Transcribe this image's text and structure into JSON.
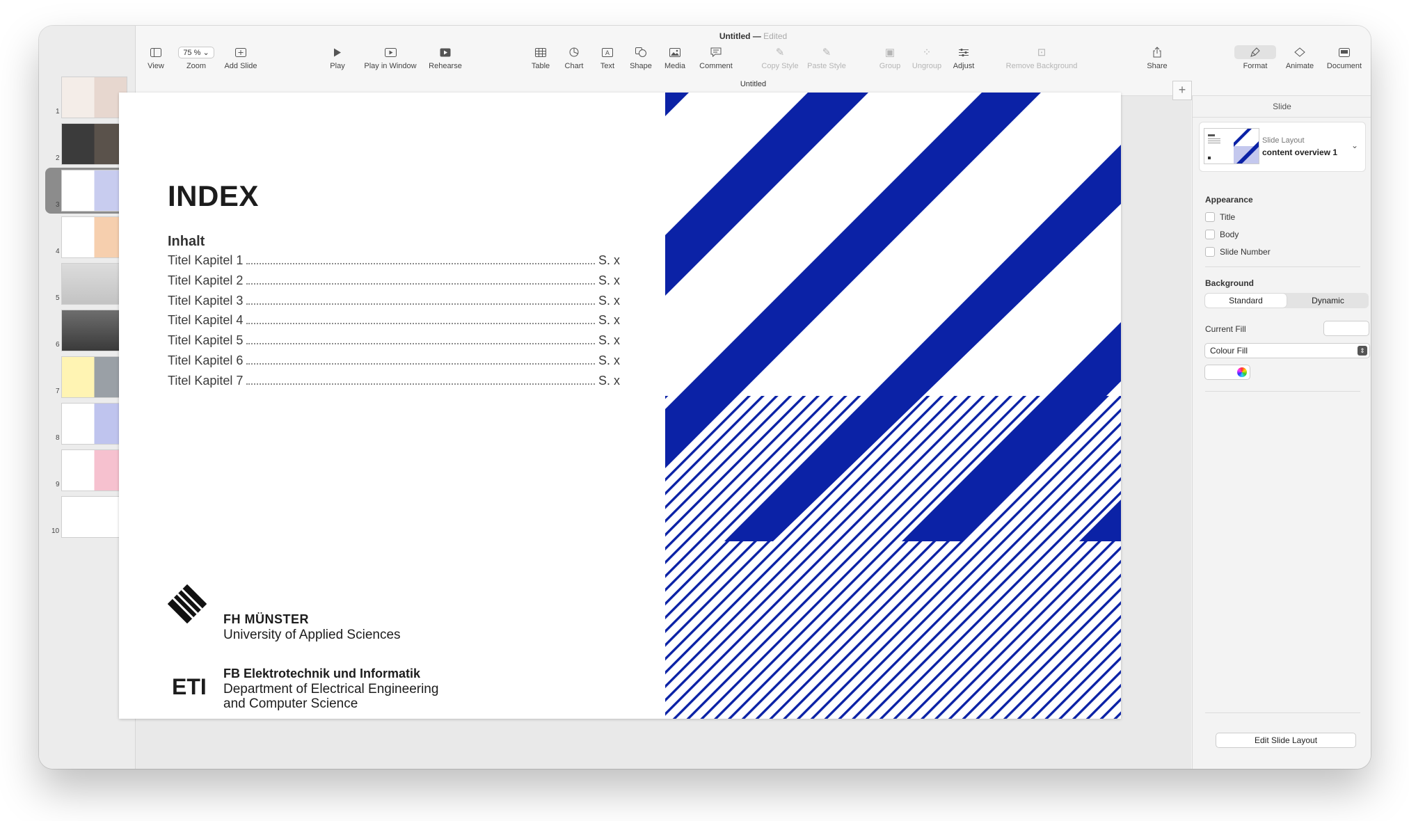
{
  "window": {
    "title": "Untitled",
    "edited_label": "Edited",
    "subtitle": "Untitled"
  },
  "toolbar": {
    "view": "View",
    "zoom": "Zoom",
    "zoom_value": "75 %",
    "add_slide": "Add Slide",
    "play": "Play",
    "play_in_window": "Play in Window",
    "rehearse": "Rehearse",
    "table": "Table",
    "chart": "Chart",
    "text": "Text",
    "shape": "Shape",
    "media": "Media",
    "comment": "Comment",
    "copy_style": "Copy Style",
    "paste_style": "Paste Style",
    "group": "Group",
    "ungroup": "Ungroup",
    "adjust": "Adjust",
    "remove_background": "Remove Background",
    "share": "Share",
    "format": "Format",
    "animate": "Animate",
    "document": "Document"
  },
  "sidebar": {
    "slide_numbers": [
      "1",
      "2",
      "3",
      "4",
      "5",
      "6",
      "7",
      "8",
      "9",
      "10"
    ],
    "selected": "3"
  },
  "slide": {
    "heading": "INDEX",
    "section": "Inhalt",
    "toc": [
      {
        "title": "Titel Kapitel 1",
        "page": "S. x"
      },
      {
        "title": "Titel Kapitel 2",
        "page": "S. x"
      },
      {
        "title": "Titel Kapitel 3",
        "page": "S. x"
      },
      {
        "title": "Titel Kapitel 4",
        "page": "S. x"
      },
      {
        "title": "Titel Kapitel 5",
        "page": "S. x"
      },
      {
        "title": "Titel Kapitel 6",
        "page": "S. x"
      },
      {
        "title": "Titel Kapitel 7",
        "page": "S. x"
      }
    ],
    "org_name": "FH MÜNSTER",
    "org_sub": "University of Applied Sciences",
    "dept_logo": "ETI",
    "dept_name": "FB Elektrotechnik und Informatik",
    "dept_line1": "Department of Electrical Engineering",
    "dept_line2": "and Computer Science",
    "accent_color": "#0b22a6"
  },
  "inspector": {
    "header": "Slide",
    "layout_label": "Slide Layout",
    "layout_value": "content overview 1",
    "appearance_title": "Appearance",
    "checkbox_title": "Title",
    "checkbox_body": "Body",
    "checkbox_slide_number": "Slide Number",
    "background_title": "Background",
    "bg_standard": "Standard",
    "bg_dynamic": "Dynamic",
    "current_fill": "Current Fill",
    "fill_type": "Colour Fill",
    "edit_layout": "Edit Slide Layout"
  }
}
